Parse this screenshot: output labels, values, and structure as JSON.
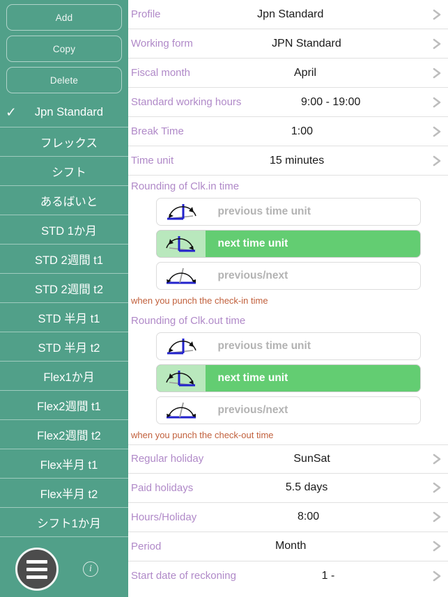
{
  "sidebar": {
    "buttons": [
      {
        "label": "Add",
        "name": "add-button"
      },
      {
        "label": "Copy",
        "name": "copy-button"
      },
      {
        "label": "Delete",
        "name": "delete-button"
      }
    ],
    "checkmark": "✓",
    "items": [
      {
        "label": "Jpn Standard",
        "selected": true
      },
      {
        "label": "フレックス",
        "selected": false
      },
      {
        "label": "シフト",
        "selected": false
      },
      {
        "label": "あるばいと",
        "selected": false
      },
      {
        "label": "STD 1か月",
        "selected": false
      },
      {
        "label": "STD 2週間 t1",
        "selected": false
      },
      {
        "label": "STD 2週間 t2",
        "selected": false
      },
      {
        "label": "STD 半月 t1",
        "selected": false
      },
      {
        "label": "STD 半月 t2",
        "selected": false
      },
      {
        "label": "Flex1か月",
        "selected": false
      },
      {
        "label": "Flex2週間 t1",
        "selected": false
      },
      {
        "label": "Flex2週間 t2",
        "selected": false
      },
      {
        "label": "Flex半月 t1",
        "selected": false
      },
      {
        "label": "Flex半月 t2",
        "selected": false
      },
      {
        "label": "シフト1か月",
        "selected": false
      }
    ],
    "menu_button": "hamburger-menu",
    "info_button": "i"
  },
  "main": {
    "rows_top": [
      {
        "label": "Profile",
        "value": "Jpn Standard"
      },
      {
        "label": "Working form",
        "value": "JPN Standard"
      },
      {
        "label": "Fiscal month",
        "value": "April"
      },
      {
        "label": "Standard working hours",
        "value": "9:00 - 19:00"
      },
      {
        "label": "Break Time",
        "value": "1:00"
      },
      {
        "label": "Time unit",
        "value": "15 minutes"
      }
    ],
    "rounding_in": {
      "heading": "Rounding of Clk.in time",
      "helper": "when you punch the check-in time",
      "options": [
        {
          "label": "previous time unit",
          "icon": "round-previous-icon",
          "selected": false
        },
        {
          "label": "next time unit",
          "icon": "round-next-icon",
          "selected": true
        },
        {
          "label": "previous/next",
          "icon": "round-nearest-icon",
          "selected": false
        }
      ]
    },
    "rounding_out": {
      "heading": "Rounding of Clk.out time",
      "helper": "when you punch the check-out time",
      "options": [
        {
          "label": "previous time unit",
          "icon": "round-previous-icon",
          "selected": false
        },
        {
          "label": "next time unit",
          "icon": "round-next-icon",
          "selected": true
        },
        {
          "label": "previous/next",
          "icon": "round-nearest-icon",
          "selected": false
        }
      ]
    },
    "rows_bottom": [
      {
        "label": "Regular holiday",
        "value": "SunSat"
      },
      {
        "label": "Paid holidays",
        "value": "5.5 days"
      },
      {
        "label": "Hours/Holiday",
        "value": "8:00"
      },
      {
        "label": "Period",
        "value": "Month"
      },
      {
        "label": "Start date of reckoning",
        "value": "1 -"
      }
    ],
    "chevron": "chevron-right-icon"
  },
  "colors": {
    "sidebar_green": "#51a089",
    "selected_green": "#63cd72",
    "label_purple": "#b089c8",
    "helper_orange": "#c1603c"
  }
}
